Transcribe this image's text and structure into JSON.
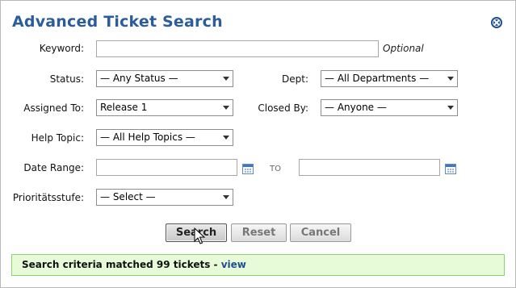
{
  "dialog": {
    "title": "Advanced Ticket Search",
    "close_icon": "close-circle-icon"
  },
  "form": {
    "keyword": {
      "label": "Keyword:",
      "value": "",
      "hint": "Optional"
    },
    "status": {
      "label": "Status:",
      "selected": "— Any Status —"
    },
    "dept": {
      "label": "Dept:",
      "selected": "— All Departments —"
    },
    "assigned_to": {
      "label": "Assigned To:",
      "selected": "Release 1"
    },
    "closed_by": {
      "label": "Closed By:",
      "selected": "— Anyone —"
    },
    "help_topic": {
      "label": "Help Topic:",
      "selected": "— All Help Topics —"
    },
    "date_range": {
      "label": "Date Range:",
      "from_value": "",
      "to_label": "TO",
      "to_value": "",
      "calendar_icon": "calendar-icon"
    },
    "priority": {
      "label": "Prioritätsstufe:",
      "selected": "— Select —"
    }
  },
  "buttons": {
    "search": "Search",
    "reset": "Reset",
    "cancel": "Cancel"
  },
  "result": {
    "text": "Search criteria matched 99 tickets",
    "separator": " - ",
    "link": "view"
  },
  "colors": {
    "title": "#2a5d9a",
    "result_bg": "#e8fbd8",
    "result_border": "#8fd26e",
    "link": "#1d4f91"
  }
}
